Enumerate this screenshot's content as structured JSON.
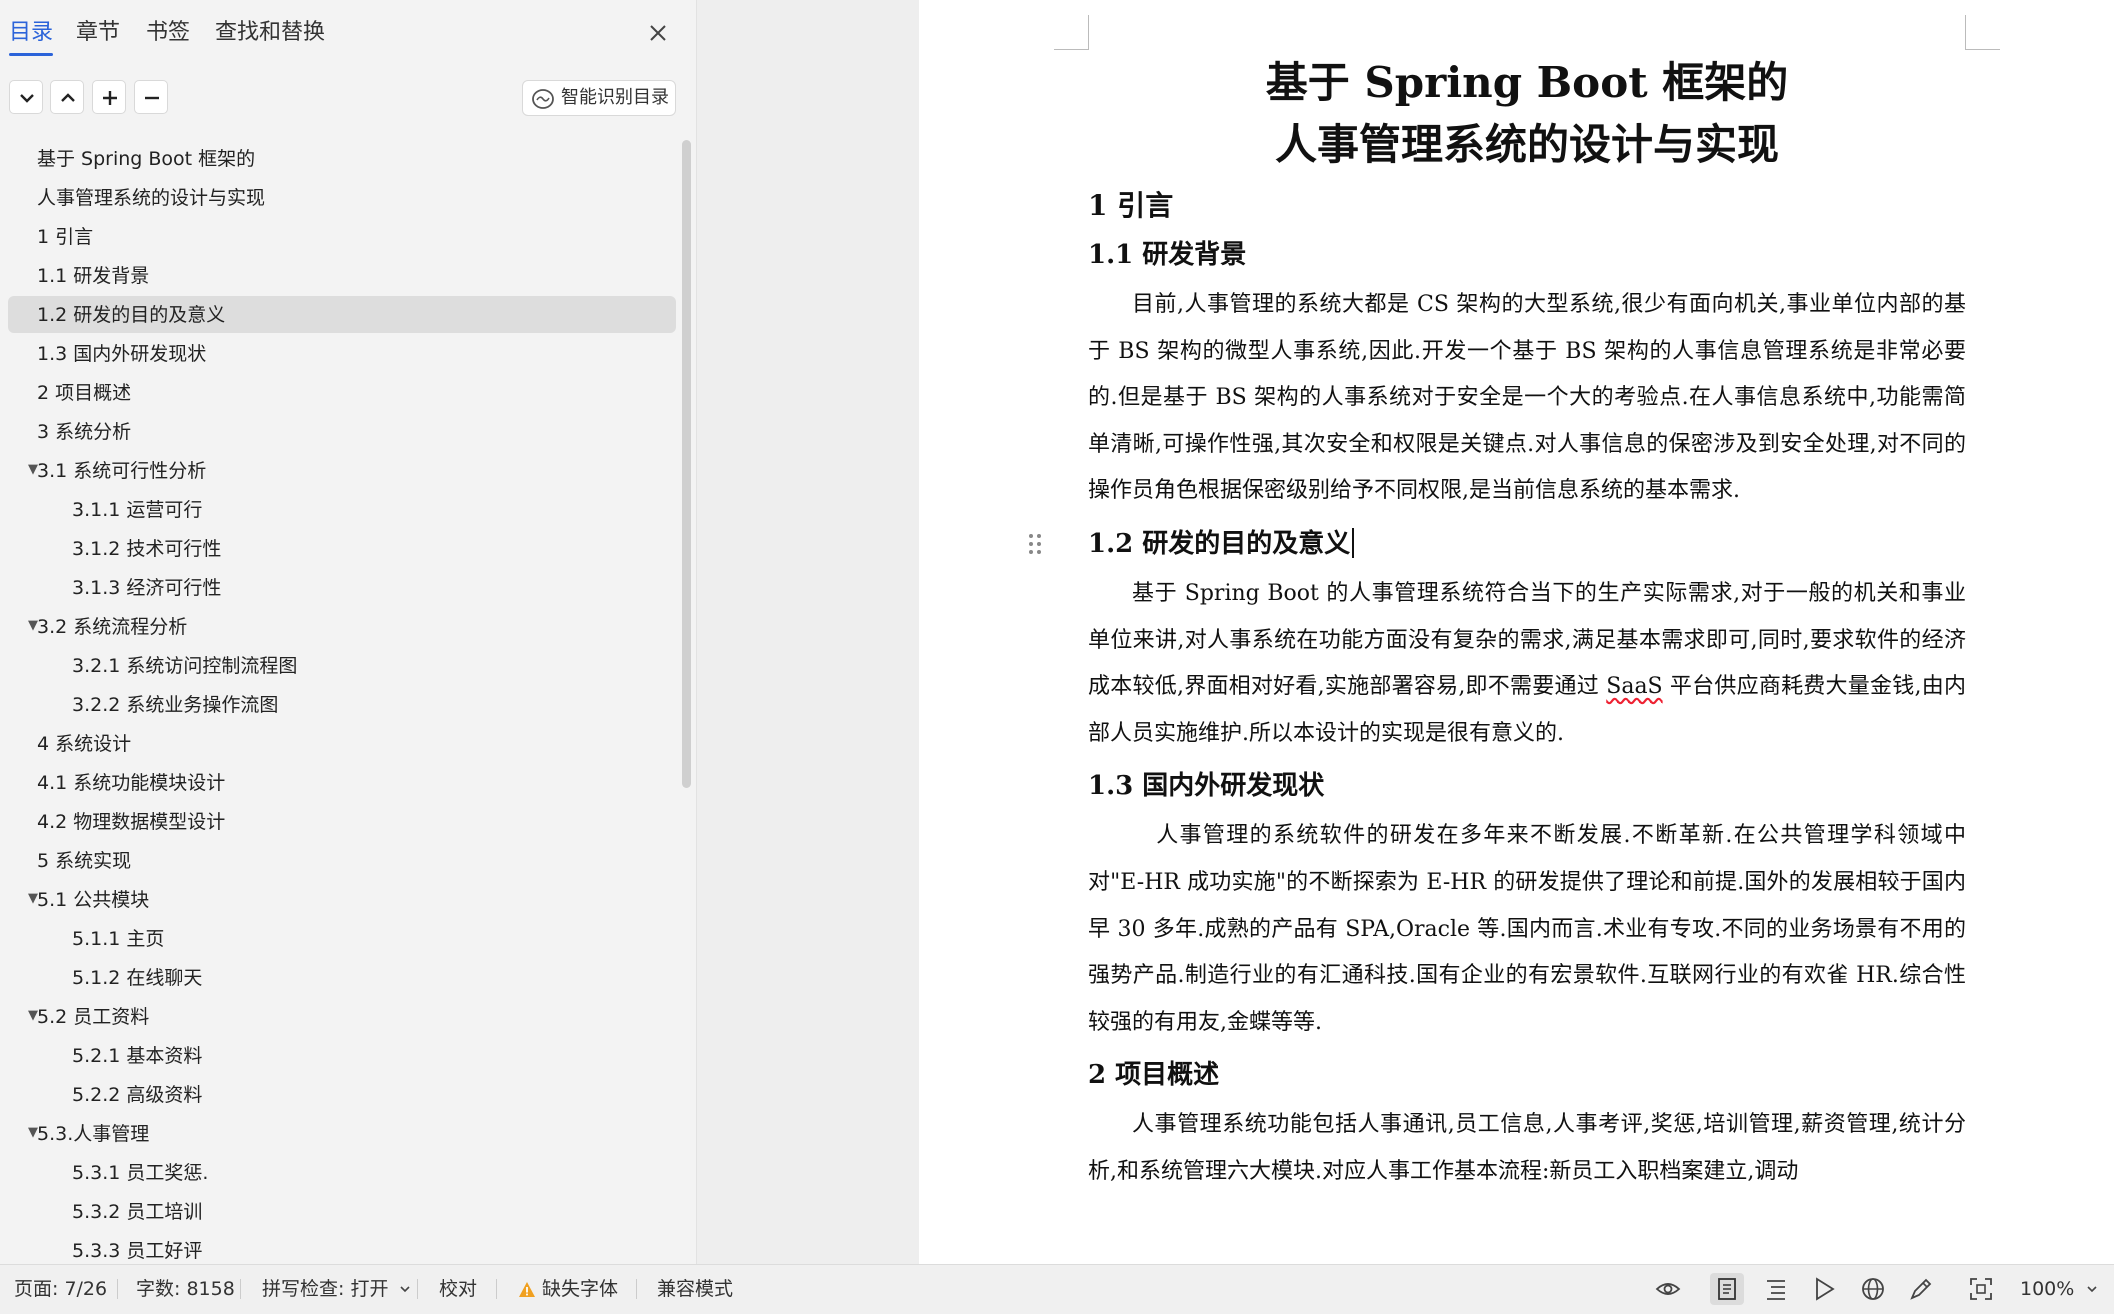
{
  "nav": {
    "tabs": [
      "目录",
      "章节",
      "书签",
      "查找和替换"
    ],
    "active_tab": "目录",
    "smart_toc_label": "智能识别目录",
    "toc": [
      {
        "label": "基于 Spring Boot 框架的",
        "level": 1
      },
      {
        "label": "人事管理系统的设计与实现",
        "level": 1
      },
      {
        "label": "1 引言",
        "level": 1
      },
      {
        "label": "1.1 研发背景",
        "level": 1
      },
      {
        "label": "1.2 研发的目的及意义",
        "level": 1,
        "selected": true
      },
      {
        "label": "1.3 国内外研发现状",
        "level": 1
      },
      {
        "label": "2 项目概述",
        "level": 1
      },
      {
        "label": "3 系统分析",
        "level": 1
      },
      {
        "label": "3.1 系统可行性分析",
        "level": 1,
        "expanded": true
      },
      {
        "label": "3.1.1 运营可行",
        "level": 2
      },
      {
        "label": "3.1.2 技术可行性",
        "level": 2
      },
      {
        "label": "3.1.3 经济可行性",
        "level": 2
      },
      {
        "label": "3.2 系统流程分析",
        "level": 1,
        "expanded": true
      },
      {
        "label": "3.2.1 系统访问控制流程图",
        "level": 2
      },
      {
        "label": "3.2.2 系统业务操作流图",
        "level": 2
      },
      {
        "label": "4 系统设计",
        "level": 1
      },
      {
        "label": "4.1 系统功能模块设计",
        "level": 1
      },
      {
        "label": "4.2 物理数据模型设计",
        "level": 1
      },
      {
        "label": "5 系统实现",
        "level": 1
      },
      {
        "label": "5.1  公共模块",
        "level": 1,
        "expanded": true
      },
      {
        "label": "5.1.1 主页",
        "level": 2
      },
      {
        "label": "5.1.2 在线聊天",
        "level": 2
      },
      {
        "label": "5.2  员工资料",
        "level": 1,
        "expanded": true
      },
      {
        "label": "5.2.1 基本资料",
        "level": 2
      },
      {
        "label": "5.2.2  高级资料",
        "level": 2
      },
      {
        "label": "5.3.人事管理",
        "level": 1,
        "expanded": true
      },
      {
        "label": "5.3.1 员工奖惩.",
        "level": 2
      },
      {
        "label": "5.3.2 员工培训",
        "level": 2
      },
      {
        "label": "5.3.3 员工好评",
        "level": 2
      }
    ]
  },
  "doc": {
    "title_line1": "基于 Spring Boot 框架的",
    "title_line2": "人事管理系统的设计与实现",
    "h_intro": "1 引言",
    "h_background": "1.1 研发背景",
    "p_background": "目前,人事管理的系统大都是 CS 架构的大型系统,很少有面向机关,事业单位内部的基于 BS 架构的微型人事系统,因此.开发一个基于 BS 架构的人事信息管理系统是非常必要的.但是基于 BS 架构的人事系统对于安全是一个大的考验点.在人事信息系统中,功能需简单清晰,可操作性强,其次安全和权限是关键点.对人事信息的保密涉及到安全处理,对不同的操作员角色根据保密级别给予不同权限,是当前信息系统的基本需求.",
    "h_purpose": "1.2 研发的目的及意义",
    "p_purpose_a": "基于 Spring Boot 的人事管理系统符合当下的生产实际需求,对于一般的机关和事业单位来讲,对人事系统在功能方面没有复杂的需求,满足基本需求即可,同时,要求软件的经济成本较低,界面相对好看,实施部署容易,即不需要通过 ",
    "p_purpose_saas": "SaaS",
    "p_purpose_b": " 平台供应商耗费大量金钱,由内部人员实施维护.所以本设计的实现是很有意义的.",
    "h_status": "1.3 国内外研发现状",
    "p_status": "人事管理的系统软件的研发在多年来不断发展.不断革新.在公共管理学科领域中对\"E-HR 成功实施\"的不断探索为 E-HR 的研发提供了理论和前提.国外的发展相较于国内早 30 多年.成熟的产品有 SPA,Oracle 等.国内而言.术业有专攻.不同的业务场景有不用的强势产品.制造行业的有汇通科技.国有企业的有宏景软件.互联网行业的有欢雀 HR.综合性较强的有用友,金蝶等等.",
    "h_overview": "2 项目概述",
    "p_overview": "人事管理系统功能包括人事通讯,员工信息,人事考评,奖惩,培训管理,薪资管理,统计分析,和系统管理六大模块.对应人事工作基本流程:新员工入职档案建立,调动"
  },
  "status": {
    "page": "页面: 7/26",
    "words": "字数: 8158",
    "spell": "拼写检查: 打开",
    "proof": "校对",
    "missing_font": "缺失字体",
    "compat": "兼容模式",
    "zoom": "100%"
  },
  "colors": {
    "accent": "#2b63d9",
    "warning": "#f0a020",
    "spell_error": "#e23333"
  }
}
